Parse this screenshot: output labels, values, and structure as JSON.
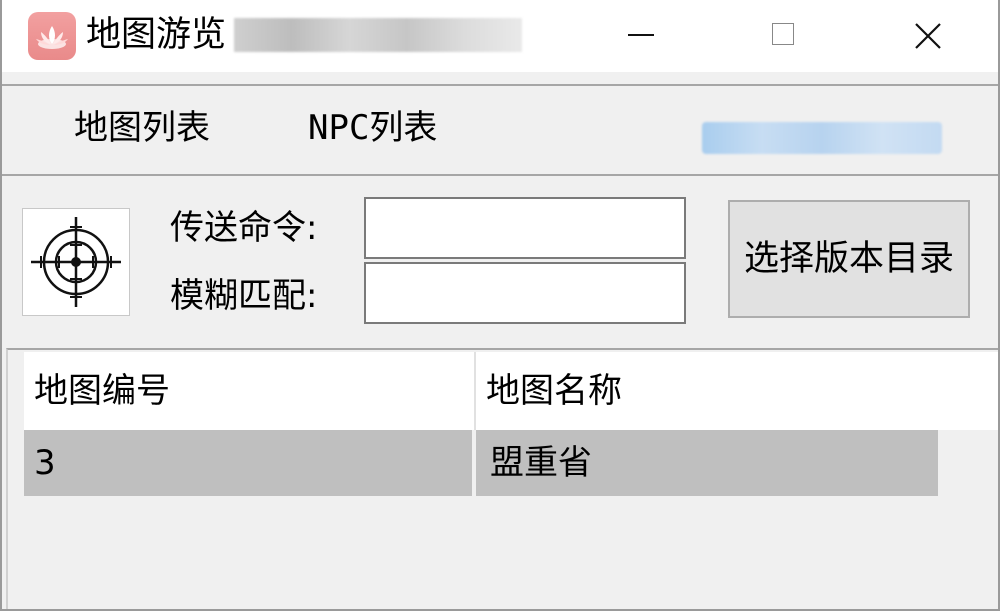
{
  "window": {
    "title": "地图游览"
  },
  "menu": {
    "items": [
      "地图列表",
      "NPC列表"
    ]
  },
  "command": {
    "teleport_label": "传送命令:",
    "fuzzy_label": "模糊匹配:",
    "teleport_value": "",
    "fuzzy_value": "",
    "select_dir_button": "选择版本目录"
  },
  "table": {
    "columns": [
      "地图编号",
      "地图名称"
    ],
    "rows": [
      [
        "3",
        "盟重省"
      ]
    ]
  },
  "icons": {
    "app": "lotus-icon",
    "target": "crosshair-icon"
  },
  "colors": {
    "selected_row": "#bfbfbf",
    "app_icon": "#e98a8a"
  }
}
